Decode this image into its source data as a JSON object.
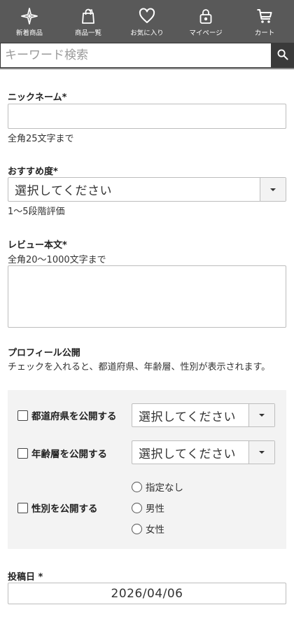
{
  "nav": {
    "items": [
      {
        "label": "新着商品",
        "icon": "sparkle-icon"
      },
      {
        "label": "商品一覧",
        "icon": "shopping-bag-icon"
      },
      {
        "label": "お気に入り",
        "icon": "heart-icon"
      },
      {
        "label": "マイページ",
        "icon": "lock-icon"
      },
      {
        "label": "カート",
        "icon": "cart-icon"
      }
    ]
  },
  "search": {
    "placeholder": "キーワード検索",
    "icon": "search-icon"
  },
  "form": {
    "nickname": {
      "label": "ニックネーム*",
      "hint": "全角25文字まで",
      "value": ""
    },
    "rating": {
      "label": "おすすめ度*",
      "selected": "選択してください",
      "hint": "1〜5段階評価"
    },
    "review": {
      "label": "レビュー本文*",
      "hint": "全角20〜1000文字まで",
      "value": ""
    },
    "profile": {
      "label": "プロフィール公開",
      "description": "チェックを入れると、都道府県、年齢層、性別が表示されます。",
      "prefecture": {
        "checkbox_label": "都道府県を公開する",
        "selected": "選択してください"
      },
      "age": {
        "checkbox_label": "年齢層を公開する",
        "selected": "選択してください"
      },
      "gender": {
        "checkbox_label": "性別を公開する",
        "options": [
          "指定なし",
          "男性",
          "女性"
        ]
      }
    },
    "post_date": {
      "label": "投稿日 *",
      "value": "2026/04/06"
    }
  }
}
